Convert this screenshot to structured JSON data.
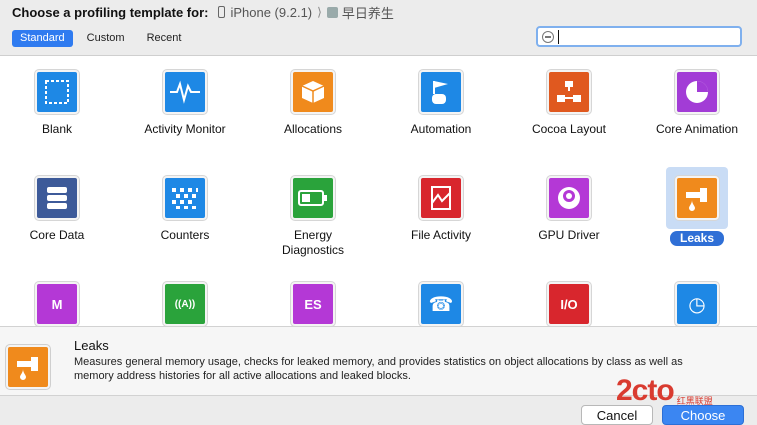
{
  "header": {
    "title": "Choose a profiling template for:",
    "device": "iPhone (9.2.1)",
    "separator": "⟩",
    "app": "早日养生"
  },
  "tabs": [
    "Standard",
    "Custom",
    "Recent"
  ],
  "search": {
    "value": "",
    "placeholder": ""
  },
  "templates": [
    {
      "label": "Blank",
      "icon": "blank-icon",
      "color": "#1e88e5"
    },
    {
      "label": "Activity Monitor",
      "icon": "activity-monitor-icon",
      "color": "#1e88e5"
    },
    {
      "label": "Allocations",
      "icon": "allocations-icon",
      "color": "#f08a1c"
    },
    {
      "label": "Automation",
      "icon": "automation-icon",
      "color": "#1e88e5"
    },
    {
      "label": "Cocoa Layout",
      "icon": "cocoa-layout-icon",
      "color": "#e0591f"
    },
    {
      "label": "Core Animation",
      "icon": "core-animation-icon",
      "color": "#a23cd6"
    },
    {
      "label": "Core Data",
      "icon": "core-data-icon",
      "color": "#3d5a99"
    },
    {
      "label": "Counters",
      "icon": "counters-icon",
      "color": "#1e88e5"
    },
    {
      "label": "Energy\nDiagnostics",
      "icon": "energy-diagnostics-icon",
      "color": "#2aa33b"
    },
    {
      "label": "File Activity",
      "icon": "file-activity-icon",
      "color": "#d8262d"
    },
    {
      "label": "GPU Driver",
      "icon": "gpu-driver-icon",
      "color": "#b438d6"
    },
    {
      "label": "Leaks",
      "icon": "leaks-icon",
      "color": "#f08a1c",
      "selected": true
    },
    {
      "label": "",
      "icon": "metal-system-trace-icon",
      "color": "#b438d6",
      "glyph": "M"
    },
    {
      "label": "",
      "icon": "network-icon",
      "color": "#2aa33b",
      "glyph": "((A))"
    },
    {
      "label": "",
      "icon": "opengl-es-icon",
      "color": "#b438d6",
      "glyph": "ES"
    },
    {
      "label": "",
      "icon": "system-trace-icon",
      "color": "#1e88e5",
      "glyph": "☎"
    },
    {
      "label": "",
      "icon": "system-usage-icon",
      "color": "#d8262d",
      "glyph": "I/O"
    },
    {
      "label": "",
      "icon": "time-profiler-icon",
      "color": "#1e88e5",
      "glyph": "◷"
    }
  ],
  "detail": {
    "title": "Leaks",
    "description": "Measures general memory usage, checks for leaked memory, and provides statistics on object allocations by class as well as memory address histories for all active allocations and leaked blocks."
  },
  "buttons": {
    "cancel": "Cancel",
    "choose": "Choose"
  },
  "watermark": {
    "main": "2cto",
    "side": "红黑联盟"
  }
}
